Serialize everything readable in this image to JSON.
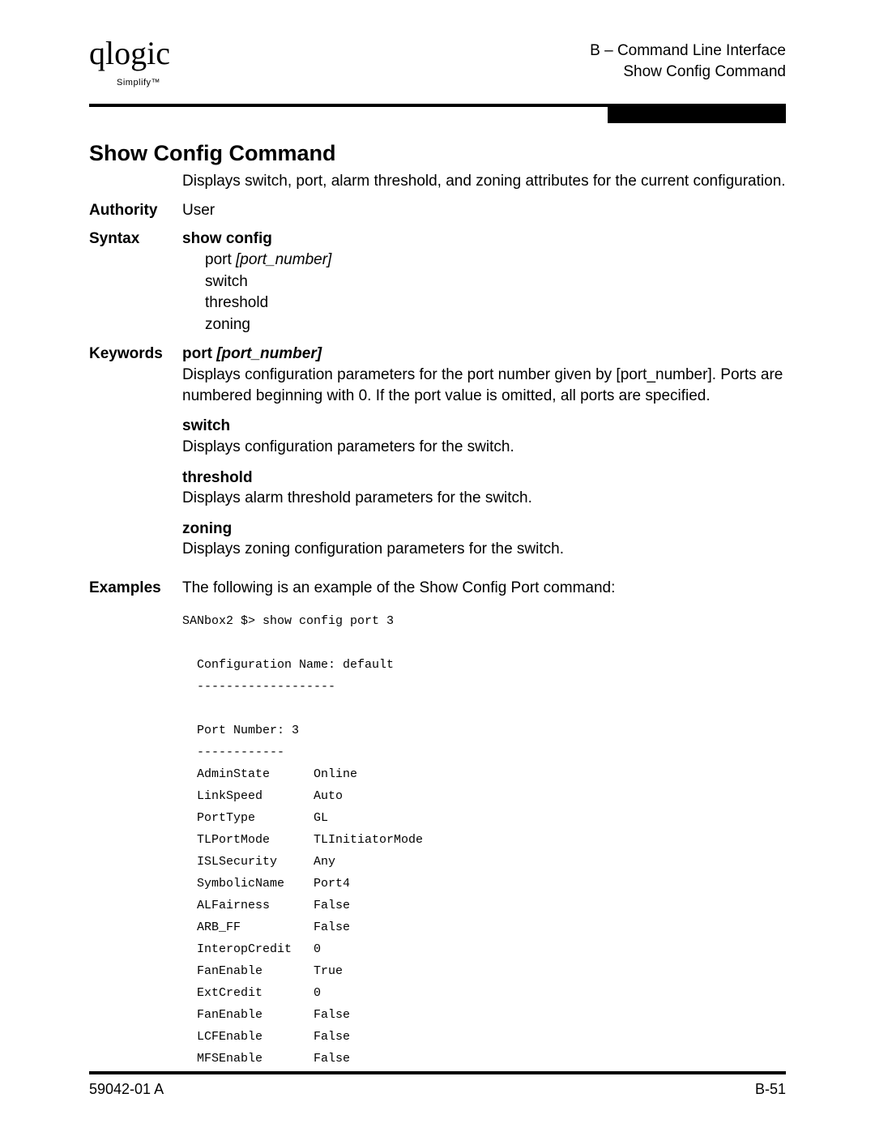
{
  "logo": {
    "brand": "qlogic",
    "tagline": "Simplify™"
  },
  "header": {
    "line1": "B – Command Line Interface",
    "line2": "Show Config Command"
  },
  "title": "Show Config Command",
  "intro": "Displays switch, port, alarm threshold, and zoning attributes for the current configuration.",
  "labels": {
    "authority": "Authority",
    "syntax": "Syntax",
    "keywords": "Keywords",
    "examples": "Examples"
  },
  "authority_value": "User",
  "syntax": {
    "cmd": "show config",
    "arg_port_prefix": "port ",
    "arg_port_param": "[port_number]",
    "arg_switch": "switch",
    "arg_threshold": "threshold",
    "arg_zoning": "zoning"
  },
  "keywords": {
    "port": {
      "title_prefix": "port ",
      "title_param": "[port_number]",
      "desc": "Displays configuration parameters for the port number given by [port_number]. Ports are numbered beginning with 0. If the port value is omitted, all ports are specified."
    },
    "switch": {
      "title": "switch",
      "desc": "Displays configuration parameters for the switch."
    },
    "threshold": {
      "title": "threshold",
      "desc": "Displays alarm threshold parameters for the switch."
    },
    "zoning": {
      "title": "zoning",
      "desc": "Displays zoning configuration parameters for the switch."
    }
  },
  "examples_intro": "The following is an example of the Show Config Port command:",
  "example_output": "SANbox2 $> show config port 3\n\n  Configuration Name: default\n  -------------------\n\n  Port Number: 3\n  ------------\n  AdminState      Online\n  LinkSpeed       Auto\n  PortType        GL\n  TLPortMode      TLInitiatorMode\n  ISLSecurity     Any\n  SymbolicName    Port4\n  ALFairness      False\n  ARB_FF          False\n  InteropCredit   0\n  FanEnable       True\n  ExtCredit       0\n  FanEnable       False\n  LCFEnable       False\n  MFSEnable       False",
  "footer": {
    "left": "59042-01 A",
    "right": "B-51"
  }
}
